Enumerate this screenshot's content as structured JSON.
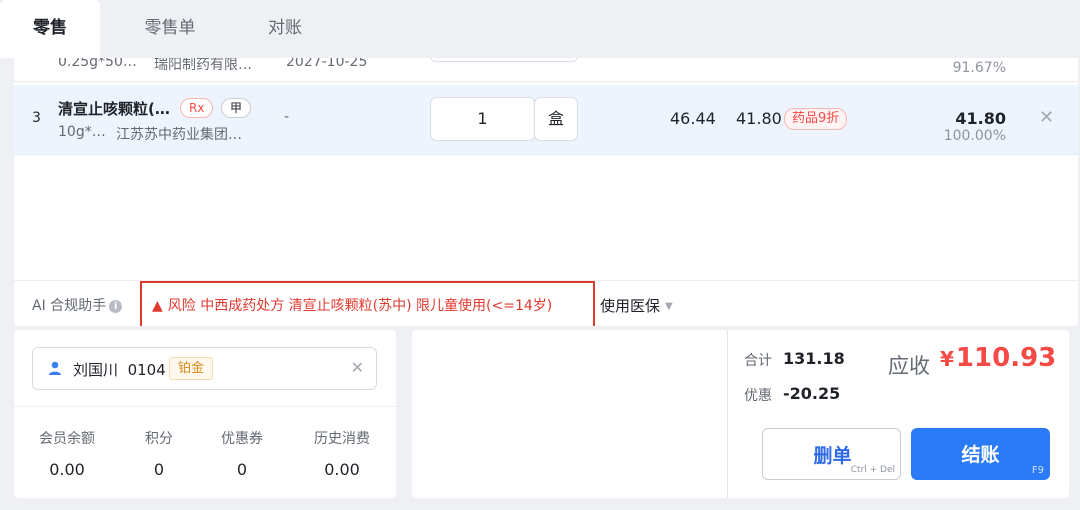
{
  "tabs": [
    {
      "label": "零售",
      "active": true
    },
    {
      "label": "零售单",
      "active": false
    },
    {
      "label": "对账",
      "active": false
    }
  ],
  "items": [
    {
      "spec": "0.25g*50…",
      "maker": "瑞阳制药有限…",
      "expiry": "2027-10-25",
      "ratio": "91.67%"
    },
    {
      "index": "3",
      "name": "清宣止咳颗粒(…",
      "tags": [
        "Rx",
        "甲"
      ],
      "spec": "10g*…",
      "maker": "江苏苏中药业集团…",
      "expiry": "-",
      "quantity": "1",
      "unit": "盒",
      "original_price": "46.44",
      "price": "41.80",
      "discount_tag": "药品9折",
      "subtotal": "41.80",
      "ratio": "100.00%"
    }
  ],
  "ai_bar": {
    "label": "AI 合规助手",
    "info_icon": "i",
    "risk_icon": "warning-triangle-icon",
    "risk_glyph": "▲",
    "risk_text": "风险  中西成药处方 清宣止咳颗粒(苏中) 限儿童使用(<=14岁)",
    "insurance_label": "使用医保"
  },
  "member": {
    "name": "刘国川",
    "code": "0104",
    "level": "铂金",
    "stats": [
      {
        "label": "会员余额",
        "value": "0.00"
      },
      {
        "label": "积分",
        "value": "0"
      },
      {
        "label": "优惠券",
        "value": "0"
      },
      {
        "label": "历史消费",
        "value": "0.00"
      }
    ]
  },
  "checkout": {
    "total_label": "合计",
    "total_value": "131.18",
    "discount_label": "优惠",
    "discount_value": "-20.25",
    "due_label": "应收",
    "currency": "¥",
    "due_amount": "110.93",
    "delete_label": "删单",
    "delete_shortcut": "Ctrl + Del",
    "pay_label": "结账",
    "pay_shortcut": "F9"
  },
  "colors": {
    "accent_blue": "#2b7bf6",
    "danger_red": "#f54a45",
    "risk_border": "#e03a2f",
    "gold_level": "#d98a1c"
  }
}
